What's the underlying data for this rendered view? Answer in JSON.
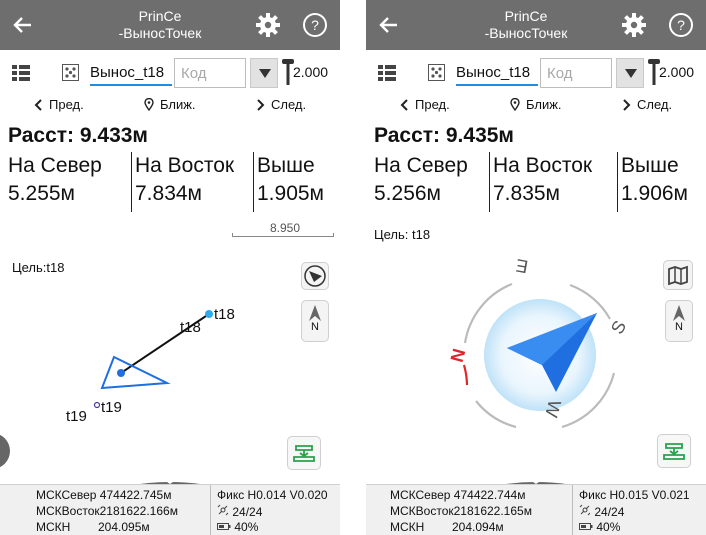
{
  "screens": [
    {
      "header": {
        "title_line1": "PrinCe",
        "title_line2": "-ВыносТочек"
      },
      "toolbar": {
        "point_name": "Вынос_t18",
        "code_placeholder": "Код",
        "height": "2.000"
      },
      "nav": {
        "prev": "Пред.",
        "near": "Ближ.",
        "next": "След."
      },
      "distance": "Расст: 9.433м",
      "columns": [
        {
          "label": "На Север",
          "value": "5.255м"
        },
        {
          "label": "На Восток",
          "value": "7.834м"
        },
        {
          "label": "Выше",
          "value": "1.905м"
        }
      ],
      "map": {
        "target_label": "Цель:t18",
        "scale_value": "8.950",
        "point_a_label": "t18",
        "point_a_label2": "t18",
        "point_b_label": "t19",
        "point_b_label2": "t19",
        "north_label": "N"
      },
      "footer": {
        "north_label": "МСКСевер",
        "north_value": "474422.745м",
        "east_label": "МСКВосток",
        "east_value": "2181622.166м",
        "h_label": "МСКН",
        "h_value": "204.095м",
        "fix": "Фикс H0.014 V0.020",
        "sats": "24/24",
        "battery": "40%"
      }
    },
    {
      "header": {
        "title_line1": "PrinCe",
        "title_line2": "-ВыносТочек"
      },
      "toolbar": {
        "point_name": "Вынос_t18",
        "code_placeholder": "Код",
        "height": "2.000"
      },
      "nav": {
        "prev": "Пред.",
        "near": "Ближ.",
        "next": "След."
      },
      "distance": "Расст: 9.435м",
      "columns": [
        {
          "label": "На Север",
          "value": "5.256м"
        },
        {
          "label": "На Восток",
          "value": "7.835м"
        },
        {
          "label": "Выше",
          "value": "1.906м"
        }
      ],
      "compass": {
        "target_label": "Цель: t18",
        "n": "N",
        "e": "E",
        "s": "S",
        "w": "W",
        "north_label": "N"
      },
      "footer": {
        "north_label": "МСКСевер",
        "north_value": "474422.744м",
        "east_label": "МСКВосток",
        "east_value": "2181622.165м",
        "h_label": "МСКН",
        "h_value": "204.094м",
        "fix": "Фикс H0.015 V0.021",
        "sats": "24/24",
        "battery": "40%"
      }
    }
  ],
  "colors": {
    "header": "#6e6e6e",
    "accent_blue": "#1f6fe0",
    "target_dot": "#2eaaf0",
    "compass_north": "#e0262b",
    "stake_green": "#2aa14b"
  },
  "icons": [
    "back-arrow-icon",
    "gear-icon",
    "help-icon",
    "list-icon",
    "points-icon",
    "dropdown-arrow-icon",
    "pole-icon",
    "chevron-left-icon",
    "location-pin-icon",
    "chevron-right-icon",
    "compass-nav-icon",
    "north-arrow-icon",
    "stakeout-icon",
    "map-book-icon",
    "satellite-icon",
    "battery-icon"
  ]
}
